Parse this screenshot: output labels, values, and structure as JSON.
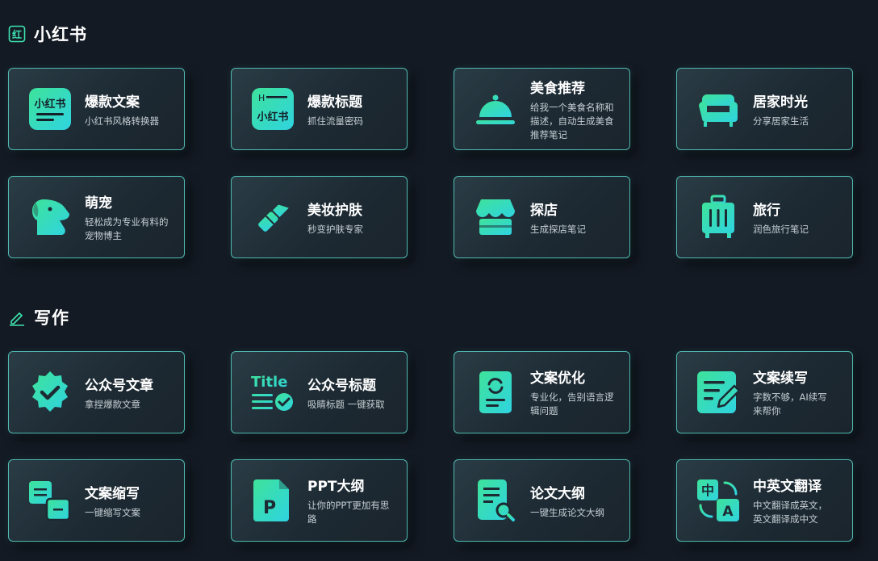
{
  "colors": {
    "accent_start": "#3ee39a",
    "accent_end": "#2fd3e0",
    "background": "#141a24",
    "card_border": "#4fb8b0"
  },
  "sections": [
    {
      "title": "小红书",
      "icon": "xiaohongshu-badge-icon",
      "icon_text": "红",
      "cards": [
        {
          "title": "爆款文案",
          "desc": "小红书风格转换器",
          "icon": "xiaohongshu-logo-icon",
          "icon_text": "小红书"
        },
        {
          "title": "爆款标题",
          "desc": "抓住流量密码",
          "icon": "xiaohongshu-heading-icon",
          "icon_text": "小红书",
          "icon_letter": "H"
        },
        {
          "title": "美食推荐",
          "desc": "给我一个美食名称和描述，自动生成美食推荐笔记",
          "icon": "food-cloche-icon"
        },
        {
          "title": "居家时光",
          "desc": "分享居家生活",
          "icon": "sofa-icon"
        },
        {
          "title": "萌宠",
          "desc": "轻松成为专业有料的宠物博主",
          "icon": "dog-icon"
        },
        {
          "title": "美妆护肤",
          "desc": "秒变护肤专家",
          "icon": "lipstick-icon"
        },
        {
          "title": "探店",
          "desc": "生成探店笔记",
          "icon": "storefront-icon"
        },
        {
          "title": "旅行",
          "desc": "润色旅行笔记",
          "icon": "luggage-icon"
        }
      ]
    },
    {
      "title": "写作",
      "icon": "pen-icon",
      "cards": [
        {
          "title": "公众号文章",
          "desc": "拿捏爆款文章",
          "icon": "verified-badge-icon"
        },
        {
          "title": "公众号标题",
          "desc": "吸睛标题 一键获取",
          "icon": "title-check-icon",
          "icon_text": "Title"
        },
        {
          "title": "文案优化",
          "desc": "专业化，告别语言逻辑问题",
          "icon": "document-refresh-icon"
        },
        {
          "title": "文案续写",
          "desc": "字数不够，AI续写来帮你",
          "icon": "note-edit-icon"
        },
        {
          "title": "文案缩写",
          "desc": "一键缩写文案",
          "icon": "text-collapse-icon"
        },
        {
          "title": "PPT大纲",
          "desc": "让你的PPT更加有思路",
          "icon": "ppt-file-icon",
          "icon_text": "P"
        },
        {
          "title": "论文大纲",
          "desc": "一键生成论文大纲",
          "icon": "document-search-icon"
        },
        {
          "title": "中英文翻译",
          "desc": "中文翻译成英文，英文翻译成中文",
          "icon": "translate-icon",
          "icon_text": "中",
          "icon_text2": "A"
        }
      ]
    }
  ]
}
